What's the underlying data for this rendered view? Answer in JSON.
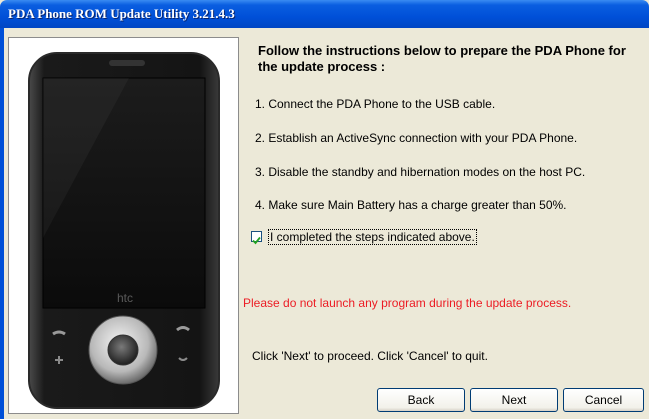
{
  "window": {
    "title": "PDA Phone ROM Update Utility 3.21.4.3"
  },
  "instructions": {
    "heading": "Follow the instructions below to prepare the PDA Phone for the update process :",
    "steps": [
      "1. Connect the PDA Phone to the USB cable.",
      "2. Establish an ActiveSync connection with your PDA Phone.",
      "3. Disable the standby and hibernation modes on the host PC.",
      "4. Make sure Main Battery has a charge greater than 50%."
    ],
    "confirm_label": "I completed the steps indicated above.",
    "confirm_checked": true
  },
  "warning": "Please do not launch any program during the update process.",
  "footer_note": "Click 'Next' to proceed. Click 'Cancel' to quit.",
  "buttons": {
    "back": "Back",
    "next": "Next",
    "cancel": "Cancel"
  },
  "phone": {
    "brand_logo": "htc"
  },
  "colors": {
    "titlebar": "#0050d8",
    "warning_text": "#ec1c24",
    "dialog_bg": "#ece9d8"
  }
}
